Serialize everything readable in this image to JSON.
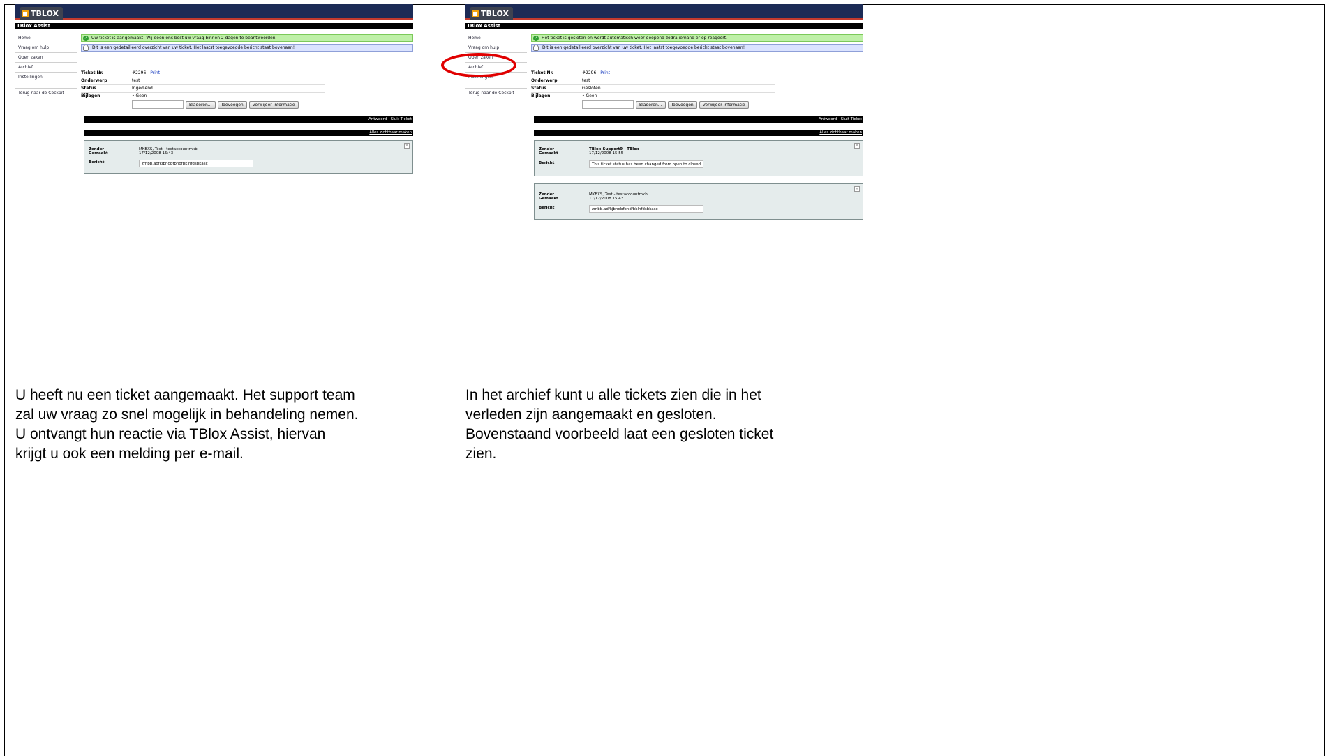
{
  "logo_text": "TBLOX",
  "app_title": "TBlox Assist",
  "sidebar": [
    "Home",
    "Vraag om hulp",
    "Open zaken",
    "Archief",
    "Instellingen",
    "Terug naar de Cockpit"
  ],
  "labels": {
    "ticket_nr": "Ticket Nr.",
    "onderwerp": "Onderwerp",
    "status": "Status",
    "bijlagen": "Bijlagen",
    "zender": "Zender",
    "gemaakt": "Gemaakt",
    "bericht": "Bericht",
    "print": "Print",
    "geen": "Geen",
    "bladeren": "Bladeren...",
    "toevoegen": "Toevoegen",
    "verwijder": "Verwijder informatie",
    "antwoord": "Antwoord",
    "sep": " - ",
    "sluit_ticket": "Sluit Ticket",
    "alles_zichtbaar": "Alles zichtbaar maken"
  },
  "left": {
    "success_msg": "Uw ticket is aangemaakt! Wij doen ons best uw vraag binnen 2 dagen te beantwoorden!",
    "info_msg": "Dit is een gedetailleerd overzicht van uw ticket. Het laatst toegevoegde bericht staat bovenaan!",
    "ticket_nr": "#2296 - ",
    "onderwerp": "test",
    "status": "Ingediend",
    "messages": [
      {
        "zender": "MKBXS, Test - testaccountmkb",
        "gemaakt": "17/12/2008 15:43",
        "bericht": "zmbb.adfkjbndbfbndfbklnfdsbkasc"
      }
    ]
  },
  "right": {
    "success_msg": "Het ticket is gesloten en wordt automatisch weer geopend zodra iemand er op reageert.",
    "info_msg": "Dit is een gedetailleerd overzicht van uw ticket. Het laatst toegevoegde bericht staat bovenaan!",
    "ticket_nr": "#2296 - ",
    "onderwerp": "test",
    "status": "Gesloten",
    "messages": [
      {
        "zender": "TBlox-Support9 - TBlox",
        "gemaakt": "17/12/2008 15:55",
        "bericht": "This ticket status has been changed from open to closed"
      },
      {
        "zender": "MKBXS, Test - testaccountmkb",
        "gemaakt": "17/12/2008 15:43",
        "bericht": "zmbb.adfkjbndbfbndfbklnfdsbkasc"
      }
    ]
  },
  "captions": {
    "left": [
      "U heeft nu een ticket aangemaakt. Het support team",
      "zal uw vraag zo snel mogelijk in behandeling nemen.",
      "U ontvangt hun reactie via TBlox Assist, hiervan",
      "krijgt u ook een melding per e-mail."
    ],
    "right": [
      "In het archief kunt u alle tickets zien die in het",
      "verleden zijn aangemaakt en gesloten.",
      "Bovenstaand voorbeeld laat een gesloten ticket",
      "zien."
    ]
  },
  "colors": {
    "accent_green": "#bff0a8",
    "accent_blue": "#dbe3ff",
    "highlight_red": "#e00000"
  }
}
